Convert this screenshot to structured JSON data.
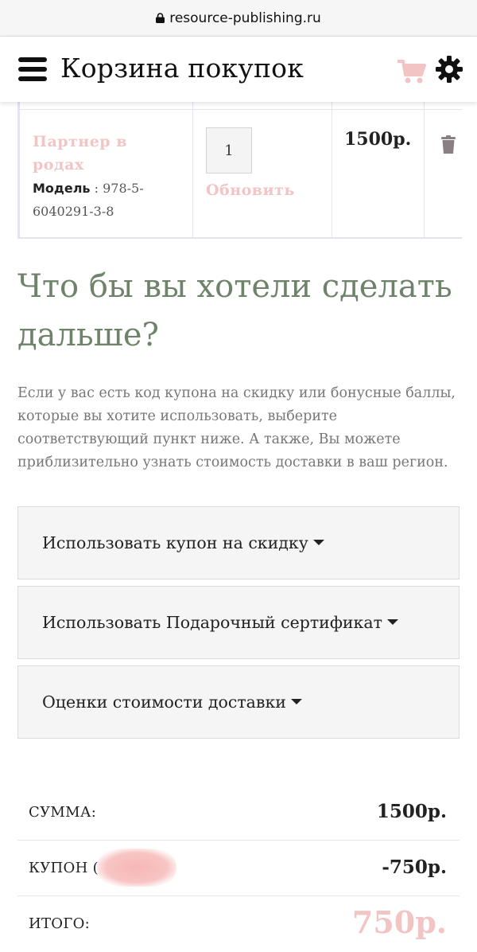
{
  "browser": {
    "url": "resource-publishing.ru"
  },
  "header": {
    "title": "Корзина покупок"
  },
  "cart": {
    "item": {
      "name": "Партнер в родах",
      "model_label": "Модель",
      "model_value": " : 978-5-6040291-3-8",
      "quantity": "1",
      "update_label": "Обновить",
      "price": "1500р."
    }
  },
  "next": {
    "heading": "Что бы вы хотели сделать дальше?",
    "description": "Если у вас есть код купона на скидку или бонусные баллы, которые вы хотите использовать, выберите соответствующий пункт ниже. А также, Вы можете приблизительно узнать стоимость доставки в ваш регион."
  },
  "panels": [
    {
      "label": "Использовать купон на скидку"
    },
    {
      "label": "Использовать Подарочный сертификат"
    },
    {
      "label": "Оценки стоимости доставки"
    }
  ],
  "totals": {
    "sum_label": "СУММА:",
    "sum_value": "1500р.",
    "coupon_label": "КУПОН (",
    "coupon_value": "-750р.",
    "total_label": "ИТОГО:",
    "total_value": "750р."
  },
  "colors": {
    "accent_pink": "#f2c4c4",
    "heading_green": "#6e836a",
    "panel_bg": "#f5f5f5"
  }
}
